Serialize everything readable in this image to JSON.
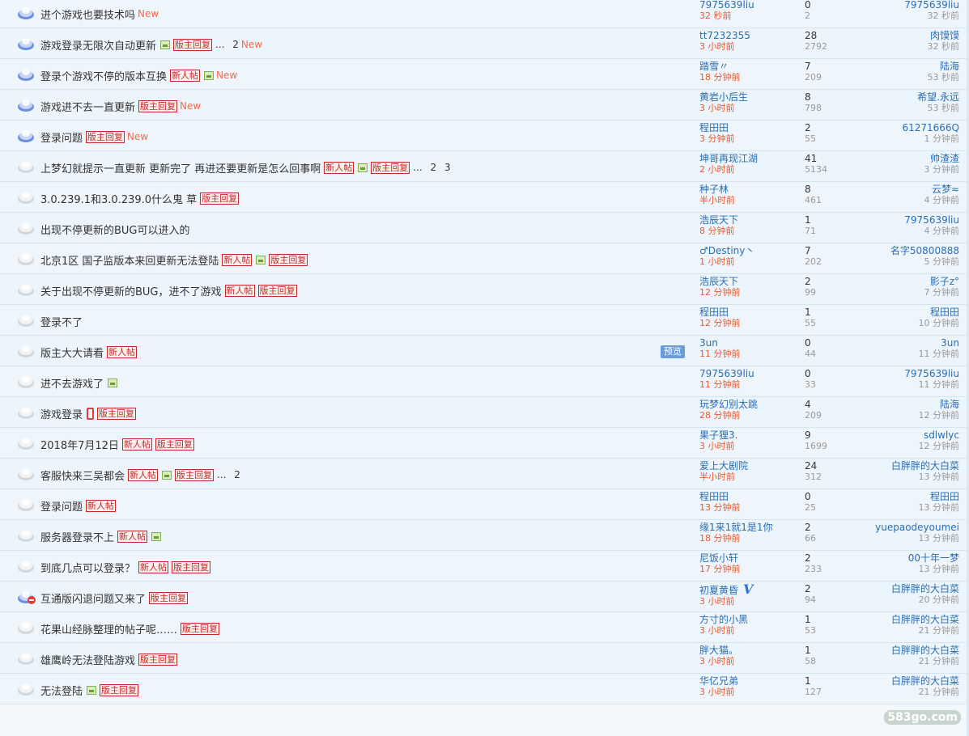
{
  "labels": {
    "preview": "预览",
    "watermark": "583go.com"
  },
  "colors": {
    "link": "#2a6db5",
    "time_red": "#e65a32",
    "tag_red": "#c62828",
    "new": "#f26c4f"
  },
  "threads": [
    {
      "icon": "globe",
      "title": "进个游戏也要技术吗",
      "tags": [],
      "pages": "",
      "new": "New",
      "author": "7975639liu",
      "author_time": "32 秒前",
      "replies": "0",
      "views": "2",
      "last_author": "7975639liu",
      "last_time": "32 秒前"
    },
    {
      "icon": "globe",
      "title": "游戏登录无限次自动更新",
      "tags": [
        "img",
        "版主回复"
      ],
      "pages": "... 2",
      "new": "New",
      "author": "tt7232355",
      "author_time": "3 小时前",
      "replies": "28",
      "views": "2792",
      "last_author": "肉馍馍",
      "last_time": "32 秒前"
    },
    {
      "icon": "globe",
      "title": "登录个游戏不停的版本互换",
      "tags": [
        "新人帖",
        "img"
      ],
      "pages": "",
      "new": "New",
      "author": "踏雪〃",
      "author_time": "18 分钟前",
      "replies": "7",
      "views": "209",
      "last_author": "陆海",
      "last_time": "53 秒前"
    },
    {
      "icon": "globe",
      "title": "游戏进不去一直更新",
      "tags": [
        "版主回复"
      ],
      "pages": "",
      "new": "New",
      "author": "黄岩小后生",
      "author_time": "3 小时前",
      "replies": "8",
      "views": "798",
      "last_author": "希望.永远",
      "last_time": "53 秒前"
    },
    {
      "icon": "globe",
      "title": "登录问题",
      "tags": [
        "版主回复"
      ],
      "pages": "",
      "new": "New",
      "author": "程田田",
      "author_time": "3 分钟前",
      "replies": "2",
      "views": "55",
      "last_author": "61271666Q",
      "last_time": "1 分钟前"
    },
    {
      "icon": "grey",
      "title": "上梦幻就提示一直更新 更新完了 再进还要更新是怎么回事啊",
      "tags": [
        "新人帖",
        "img",
        "版主回复"
      ],
      "pages": "... 2 3",
      "new": "",
      "author": "坤哥再现江湖",
      "author_time": "2 小时前",
      "replies": "41",
      "views": "5134",
      "last_author": "帅渣渣",
      "last_time": "3 分钟前"
    },
    {
      "icon": "grey",
      "title": "3.0.239.1和3.0.239.0什么鬼 草",
      "tags": [
        "版主回复"
      ],
      "pages": "",
      "new": "",
      "author": "种子林",
      "author_time": "半小时前",
      "replies": "8",
      "views": "461",
      "last_author": "云梦≈",
      "last_time": "4 分钟前"
    },
    {
      "icon": "grey",
      "title": "出现不停更新的BUG可以进入的",
      "tags": [],
      "pages": "",
      "new": "",
      "author": "浩辰天下",
      "author_time": "8 分钟前",
      "replies": "1",
      "views": "71",
      "last_author": "7975639liu",
      "last_time": "4 分钟前"
    },
    {
      "icon": "grey",
      "title": "北京1区 国子监版本来回更新无法登陆",
      "tags": [
        "新人帖",
        "img",
        "版主回复"
      ],
      "pages": "",
      "new": "",
      "author": "♂Destiny丶",
      "author_time": "1 小时前",
      "replies": "7",
      "views": "202",
      "last_author": "名字50800888",
      "last_time": "5 分钟前"
    },
    {
      "icon": "grey",
      "title": "关于出现不停更新的BUG，进不了游戏",
      "tags": [
        "新人帖",
        "版主回复"
      ],
      "pages": "",
      "new": "",
      "author": "浩辰天下",
      "author_time": "12 分钟前",
      "replies": "2",
      "views": "99",
      "last_author": "影子z°",
      "last_time": "7 分钟前"
    },
    {
      "icon": "grey",
      "title": "登录不了",
      "tags": [],
      "pages": "",
      "new": "",
      "author": "程田田",
      "author_time": "12 分钟前",
      "replies": "1",
      "views": "55",
      "last_author": "程田田",
      "last_time": "10 分钟前"
    },
    {
      "icon": "grey",
      "title": "版主大大请看",
      "tags": [
        "新人帖"
      ],
      "pages": "",
      "new": "",
      "preview": true,
      "author": "3un",
      "author_time": "11 分钟前",
      "replies": "0",
      "views": "44",
      "last_author": "3un",
      "last_time": "11 分钟前"
    },
    {
      "icon": "grey",
      "title": "进不去游戏了",
      "tags": [
        "img"
      ],
      "pages": "",
      "new": "",
      "author": "7975639liu",
      "author_time": "11 分钟前",
      "replies": "0",
      "views": "33",
      "last_author": "7975639liu",
      "last_time": "11 分钟前"
    },
    {
      "icon": "grey",
      "title": "游戏登录",
      "tags": [
        "phone",
        "版主回复"
      ],
      "pages": "",
      "new": "",
      "author": "玩梦幻别太跳",
      "author_time": "28 分钟前",
      "replies": "4",
      "views": "209",
      "last_author": "陆海",
      "last_time": "12 分钟前"
    },
    {
      "icon": "grey",
      "title": "2018年7月12日",
      "tags": [
        "新人帖",
        "版主回复"
      ],
      "pages": "",
      "new": "",
      "author": "果子狸3.",
      "author_time": "3 小时前",
      "replies": "9",
      "views": "1699",
      "last_author": "sdlwlyc",
      "last_time": "12 分钟前"
    },
    {
      "icon": "grey",
      "title": "客服快来三吴都会",
      "tags": [
        "新人帖",
        "img",
        "版主回复"
      ],
      "pages": "... 2",
      "new": "",
      "author": "爱上大剧院",
      "author_time": "半小时前",
      "replies": "24",
      "views": "312",
      "last_author": "白胖胖的大白菜",
      "last_time": "13 分钟前"
    },
    {
      "icon": "grey",
      "title": "登录问题",
      "tags": [
        "新人帖"
      ],
      "pages": "",
      "new": "",
      "author": "程田田",
      "author_time": "13 分钟前",
      "replies": "0",
      "views": "25",
      "last_author": "程田田",
      "last_time": "13 分钟前"
    },
    {
      "icon": "grey",
      "title": "服务器登录不上",
      "tags": [
        "新人帖",
        "img"
      ],
      "pages": "",
      "new": "",
      "author": "缘1来1就1是1你",
      "author_time": "18 分钟前",
      "replies": "2",
      "views": "66",
      "last_author": "yuepaodeyoumei",
      "last_time": "13 分钟前"
    },
    {
      "icon": "grey",
      "title": "到底几点可以登录？",
      "tags": [
        "新人帖",
        "版主回复"
      ],
      "pages": "",
      "new": "",
      "author": "尼饭小轩",
      "author_time": "17 分钟前",
      "replies": "2",
      "views": "233",
      "last_author": "00十年一梦",
      "last_time": "13 分钟前"
    },
    {
      "icon": "locked",
      "title": "互通版闪退问题又来了",
      "tags": [
        "版主回复"
      ],
      "pages": "",
      "new": "",
      "vip": true,
      "author": "初夏黄昏",
      "author_time": "3 小时前",
      "replies": "2",
      "views": "94",
      "last_author": "白胖胖的大白菜",
      "last_time": "20 分钟前"
    },
    {
      "icon": "grey",
      "title": "花果山经脉整理的帖子呢……",
      "tags": [
        "版主回复"
      ],
      "pages": "",
      "new": "",
      "author": "方寸的小黑",
      "author_time": "3 小时前",
      "replies": "1",
      "views": "53",
      "last_author": "白胖胖的大白菜",
      "last_time": "21 分钟前"
    },
    {
      "icon": "grey",
      "title": "雄鹰岭无法登陆游戏",
      "tags": [
        "版主回复"
      ],
      "pages": "",
      "new": "",
      "author": "胖大猫。",
      "author_time": "3 小时前",
      "replies": "1",
      "views": "58",
      "last_author": "白胖胖的大白菜",
      "last_time": "21 分钟前"
    },
    {
      "icon": "grey",
      "title": "无法登陆",
      "tags": [
        "img",
        "版主回复"
      ],
      "pages": "",
      "new": "",
      "author": "华亿兄弟",
      "author_time": "3 小时前",
      "replies": "1",
      "views": "127",
      "last_author": "白胖胖的大白菜",
      "last_time": "21 分钟前"
    }
  ]
}
